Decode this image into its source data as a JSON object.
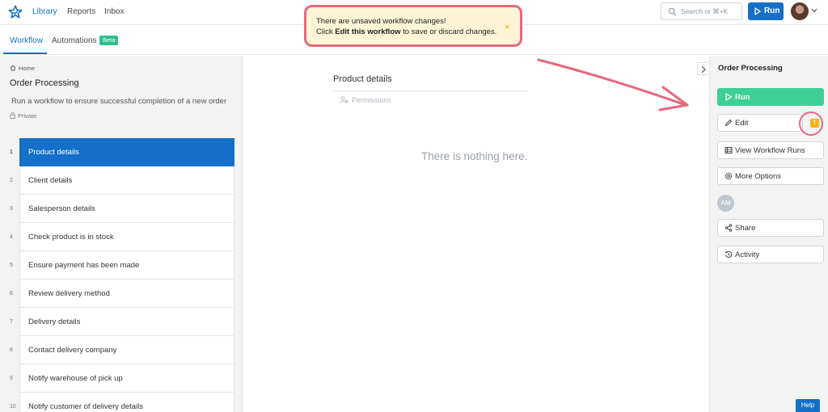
{
  "topbar": {
    "nav": [
      "Library",
      "Reports",
      "Inbox"
    ],
    "search_placeholder": "Search or ⌘+K",
    "run_label": "Run"
  },
  "subbar": {
    "tabs": [
      "Workflow",
      "Automations"
    ],
    "beta_label": "Beta"
  },
  "toast": {
    "line1": "There are unsaved workflow changes!",
    "line2_pre": "Click ",
    "line2_bold": "Edit this workflow",
    "line2_post": " to save or discard changes.",
    "close_glyph": "×"
  },
  "left": {
    "breadcrumb": "Home",
    "title": "Order Processing",
    "description": "Run a workflow to ensure successful completion of a new order",
    "visibility": "Private",
    "steps": [
      {
        "num": "1",
        "label": "Product details"
      },
      {
        "num": "2",
        "label": "Client details"
      },
      {
        "num": "3",
        "label": "Salesperson details"
      },
      {
        "num": "4",
        "label": "Check product is in stock"
      },
      {
        "num": "5",
        "label": "Ensure payment has been made"
      },
      {
        "num": "6",
        "label": "Review delivery method"
      },
      {
        "num": "7",
        "label": "Delivery details"
      },
      {
        "num": "8",
        "label": "Contact delivery company"
      },
      {
        "num": "9",
        "label": "Notify warehouse of pick up"
      },
      {
        "num": "10",
        "label": "Notify customer of delivery details"
      }
    ],
    "active_step": 0
  },
  "center": {
    "title": "Product details",
    "permissions": "Permissions",
    "empty": "There is nothing here."
  },
  "right": {
    "title": "Order Processing",
    "run": "Run",
    "edit": "Edit",
    "edit_badge": "!",
    "view_runs": "View Workflow Runs",
    "more": "More Options",
    "avatar_initials": "AM",
    "share": "Share",
    "activity": "Activity"
  },
  "help": "Help",
  "colors": {
    "accent": "#1470c8",
    "run_green": "#3ecf96",
    "annotation_pink": "#e8677d",
    "warning": "#f5b21b"
  }
}
